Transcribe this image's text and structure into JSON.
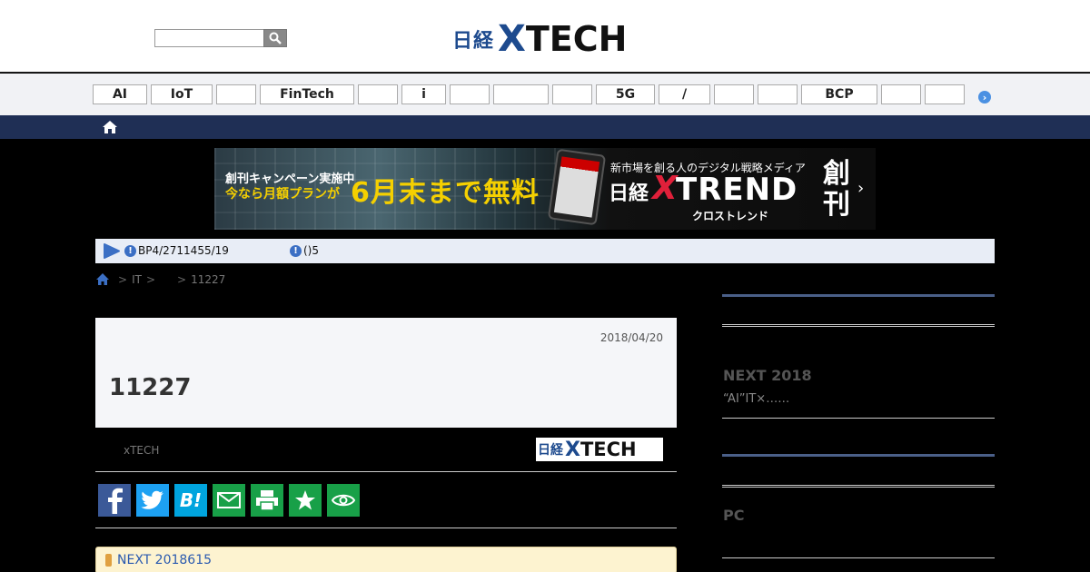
{
  "header": {
    "search_placeholder": "",
    "logo_jp": "日経",
    "logo_x": "X",
    "logo_tech": "TECH"
  },
  "tags": [
    "AI",
    "IoT",
    "",
    "FinTech",
    "",
    "i",
    "",
    "",
    "",
    "5G",
    "/",
    "",
    "",
    "BCP",
    "",
    ""
  ],
  "banner": {
    "line1": "創刊キャンペーン実施中",
    "line2": "今なら月額プランが",
    "big": "6月末まで無料",
    "sub": "新市場を創る人のデジタル戦略メディア",
    "brand_jp": "日経",
    "brand_x": "X",
    "brand_rest": "TREND",
    "kana": "クロストレンド",
    "sokan": "創刊"
  },
  "alerts": {
    "item1": "BP4/2711455/19",
    "item2": "()5"
  },
  "breadcrumb": {
    "item1": "IT",
    "item2": "11227"
  },
  "article": {
    "date": "2018/04/20",
    "title": "11227",
    "byline": "xTECH",
    "logo_jp": "日経",
    "logo_x": "X",
    "logo_tech": "TECH"
  },
  "share": {
    "hatena": "B!"
  },
  "notice": {
    "text": "NEXT 2018615"
  },
  "sidebar": {
    "heading1": "NEXT 2018",
    "desc1": "“AI”IT×……",
    "heading2": "PC"
  },
  "colors": {
    "navy": "#1f2f55",
    "brand_blue": "#1d4a8e",
    "facebook": "#3b5998",
    "twitter": "#1da1f2",
    "hatena": "#00a4de",
    "green": "#18a048"
  }
}
